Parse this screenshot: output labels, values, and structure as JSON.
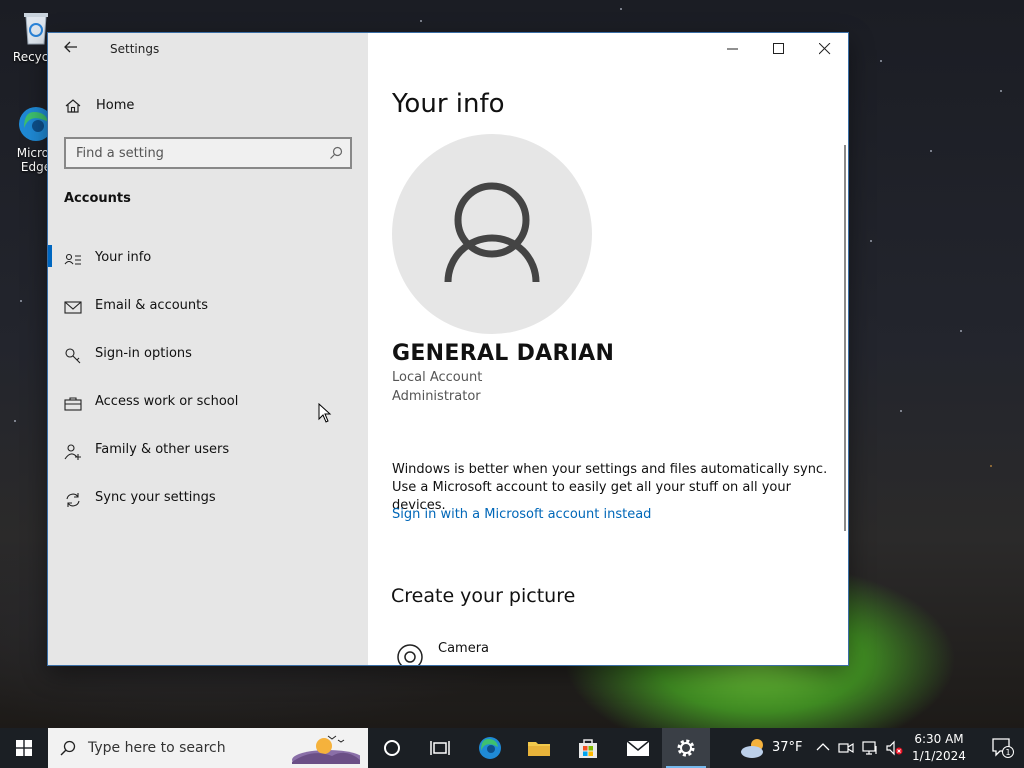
{
  "desktop": {
    "icons": [
      {
        "label": "Recycle"
      },
      {
        "label": "Micros Edge"
      }
    ]
  },
  "window": {
    "title": "Settings",
    "sidebar": {
      "home_label": "Home",
      "search_placeholder": "Find a setting",
      "section_label": "Accounts",
      "items": [
        {
          "label": "Your info",
          "icon": "person-list-icon",
          "active": true
        },
        {
          "label": "Email & accounts",
          "icon": "mail-icon",
          "active": false
        },
        {
          "label": "Sign-in options",
          "icon": "key-icon",
          "active": false
        },
        {
          "label": "Access work or school",
          "icon": "briefcase-icon",
          "active": false
        },
        {
          "label": "Family & other users",
          "icon": "person-add-icon",
          "active": false
        },
        {
          "label": "Sync your settings",
          "icon": "sync-icon",
          "active": false
        }
      ]
    },
    "main": {
      "page_title": "Your info",
      "user_name": "GENERAL DARIAN",
      "account_type": "Local Account",
      "account_role": "Administrator",
      "sync_text": "Windows is better when your settings and files automatically sync. Use a Microsoft account to easily get all your stuff on all your devices.",
      "ms_account_link": "Sign in with a Microsoft account instead",
      "create_picture_heading": "Create your picture",
      "camera_label": "Camera"
    }
  },
  "taskbar": {
    "search_placeholder": "Type here to search",
    "weather_temp": "37°F",
    "time": "6:30 AM",
    "date": "1/1/2024",
    "notification_count": "1"
  },
  "colors": {
    "accent": "#0067c0",
    "link": "#0067b8",
    "sidebar_bg": "#e6e6e6",
    "taskbar_bg": "#1b1f24"
  }
}
